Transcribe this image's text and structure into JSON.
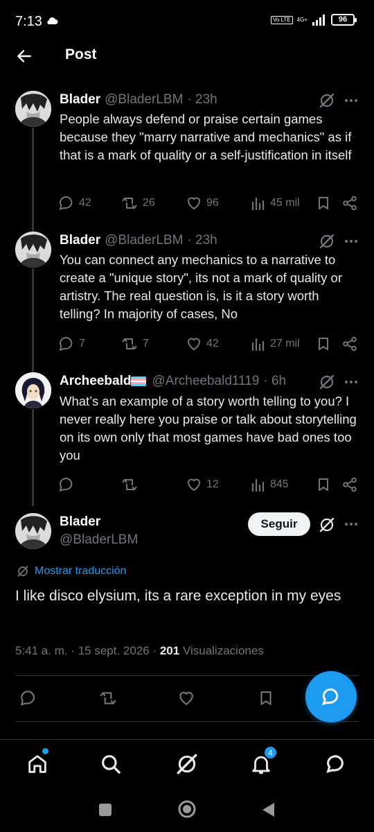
{
  "status_bar": {
    "time": "7:13",
    "volte": "Vo LTE",
    "network": "4G+",
    "battery": "96"
  },
  "header": {
    "title": "Post"
  },
  "replies": [
    {
      "name": "Blader",
      "flag": false,
      "handle": "@BladerLBM",
      "time": "· 23h",
      "text": "People always defend or praise certain games because they \"marry narrative and mechanics\" as if that is a mark of quality or a self-justification in itself",
      "replies": "42",
      "reposts": "26",
      "likes": "96",
      "views": "45 mil"
    },
    {
      "name": "Blader",
      "flag": false,
      "handle": "@BladerLBM",
      "time": "· 23h",
      "text": "You can connect any mechanics to a narrative to create a \"unique story\", its not a mark of quality or artistry. The real question is, is it a story worth telling? In majority of cases, No",
      "replies": "7",
      "reposts": "7",
      "likes": "42",
      "views": "27 mil"
    },
    {
      "name": "Archeebald",
      "flag": true,
      "handle": "@Archeebald1119",
      "time": "· 6h",
      "text": "What’s an example of a story worth telling to you? I never really here you praise or talk about storytelling on its own only that most games have bad ones too you",
      "replies": "",
      "reposts": "",
      "likes": "12",
      "views": "845"
    }
  ],
  "main_post": {
    "name": "Blader",
    "handle": "@BladerLBM",
    "follow_label": "Seguir",
    "translate_label": "Mostrar traducción",
    "text": "I like disco elysium, its a rare exception in my eyes",
    "timestamp": "5:41 a. m. · 15 sept. 2026 · ",
    "views_count": "201",
    "views_label": " Visualizaciones"
  },
  "bottom_nav": {
    "notification_count": "4"
  },
  "colors": {
    "accent": "#1d9bf0",
    "background": "#000000",
    "muted": "#71767b",
    "text": "#e7e9ea"
  }
}
